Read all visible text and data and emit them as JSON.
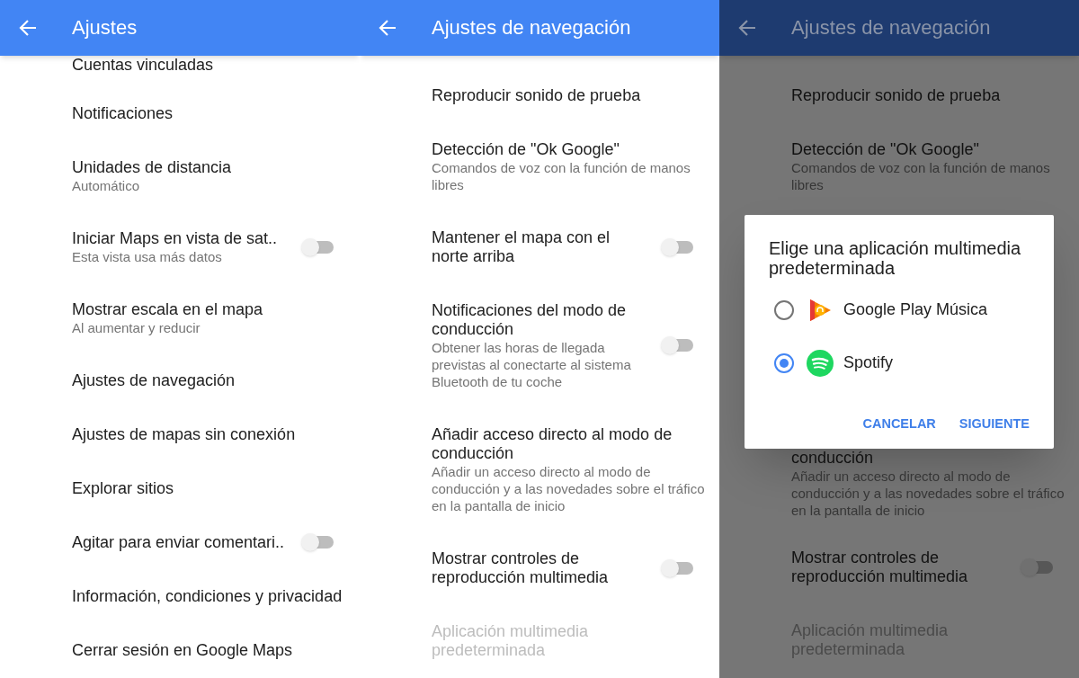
{
  "screens": [
    {
      "dimmed": false,
      "header": {
        "title": "Ajustes"
      },
      "items": [
        {
          "kind": "partial",
          "title": "Cuentas vinculadas"
        },
        {
          "kind": "plain",
          "title": "Notificaciones"
        },
        {
          "kind": "plain",
          "title": "Unidades de distancia",
          "subtitle": "Automático"
        },
        {
          "kind": "toggle",
          "title": "Iniciar Maps en vista de sat..",
          "subtitle": "Esta vista usa más datos",
          "on": false
        },
        {
          "kind": "plain",
          "title": "Mostrar escala en el mapa",
          "subtitle": "Al aumentar y reducir"
        },
        {
          "kind": "plain",
          "title": "Ajustes de navegación"
        },
        {
          "kind": "plain",
          "title": "Ajustes de mapas sin conexión"
        },
        {
          "kind": "plain",
          "title": "Explorar sitios"
        },
        {
          "kind": "toggle",
          "title": "Agitar para enviar comentari..",
          "on": false
        },
        {
          "kind": "plain",
          "title": "Información, condiciones y privacidad"
        },
        {
          "kind": "plain",
          "title": "Cerrar sesión en Google Maps"
        }
      ]
    },
    {
      "dimmed": false,
      "header": {
        "title": "Ajustes de navegación"
      },
      "items": [
        {
          "kind": "plain",
          "title": "Reproducir sonido de prueba",
          "disabled": false
        },
        {
          "kind": "plain",
          "title": "Detección de \"Ok Google\"",
          "subtitle": "Comandos de voz con la función de manos libres",
          "disabled": false
        },
        {
          "kind": "toggle",
          "title": "Mantener el mapa con el norte arriba",
          "on": false,
          "disabled": false
        },
        {
          "kind": "toggle",
          "title": "Notificaciones del modo de conducción",
          "subtitle": "Obtener las horas de llegada previstas al conectarte al sistema Bluetooth de tu coche",
          "on": false,
          "disabled": false
        },
        {
          "kind": "plain",
          "title": "Añadir acceso directo al modo de conducción",
          "subtitle": "Añadir un acceso directo al modo de conducción y a las novedades sobre el tráfico en la pantalla de inicio",
          "disabled": false
        },
        {
          "kind": "toggle",
          "title": "Mostrar controles de reproducción multimedia",
          "on": false,
          "disabled": false
        },
        {
          "kind": "plain",
          "title": "Aplicación multimedia predeterminada",
          "disabled": true
        }
      ]
    },
    {
      "dimmed": true,
      "header": {
        "title": "Ajustes de navegación"
      },
      "items": [
        {
          "kind": "plain",
          "title": "Reproducir sonido de prueba",
          "disabled": false
        },
        {
          "kind": "plain",
          "title": "Detección de \"Ok Google\"",
          "subtitle": "Comandos de voz con la función de manos libres",
          "disabled": false
        }
      ],
      "dialog": {
        "title": "Elige una aplicación multimedia predeterminada",
        "options": [
          {
            "label": "Google Play Música",
            "selected": false
          },
          {
            "label": "Spotify",
            "selected": true
          }
        ],
        "buttons": [
          "CANCELAR",
          "SIGUIENTE"
        ]
      },
      "items_below": [
        {
          "kind": "partial",
          "title": "conducción",
          "subtitle": "Añadir un acceso directo al modo de conducción y a las novedades sobre el tráfico en la pantalla de inicio",
          "disabled": false
        },
        {
          "kind": "toggle",
          "title": "Mostrar controles de reproducción multimedia",
          "on": false,
          "disabled": false
        },
        {
          "kind": "plain",
          "title": "Aplicación multimedia predeterminada",
          "disabled": true
        }
      ]
    }
  ]
}
